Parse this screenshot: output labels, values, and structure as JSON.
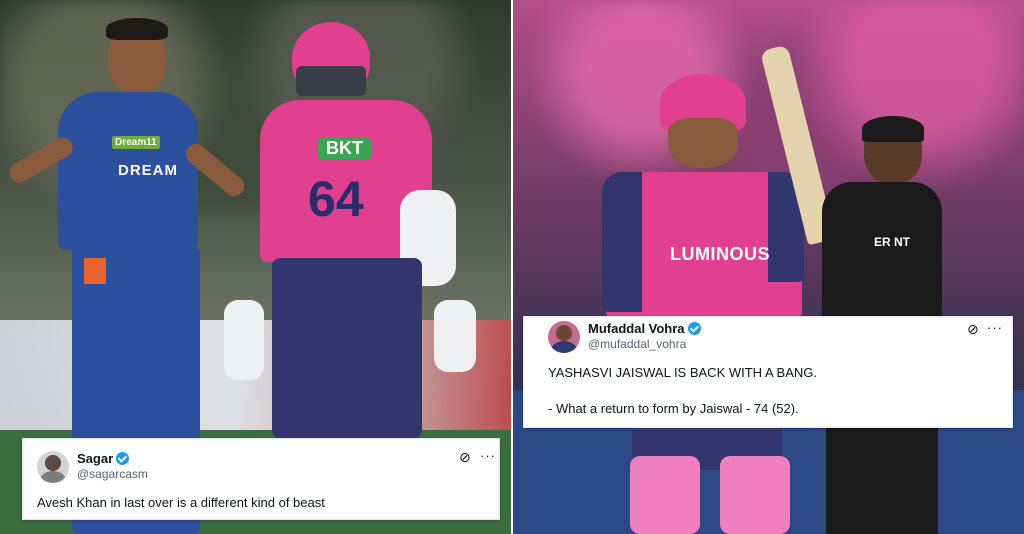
{
  "left_photo": {
    "bowler_jersey_sponsor": "DREAM",
    "bowler_jersey_badge": "Dream11",
    "batter_jersey_sponsor": "BKT",
    "batter_number": "64"
  },
  "right_photo": {
    "batter_jersey_sponsor": "LUMINOUS",
    "umpire_shirt_text": "ER NT"
  },
  "tweets": [
    {
      "name": "Sagar",
      "handle": "@sagarcasm",
      "verified": true,
      "lines": [
        "Avesh Khan in last over is a different kind of beast"
      ]
    },
    {
      "name": "Mufaddal Vohra",
      "handle": "@mufaddal_vohra",
      "verified": true,
      "lines": [
        "YASHASVI JAISWAL IS BACK WITH A BANG.",
        "- What a return to form by Jaiswal - 74 (52)."
      ]
    }
  ],
  "icons": {
    "grok": "⊘",
    "more": "···"
  },
  "colors": {
    "lsg_blue": "#2c4f9e",
    "rr_pink": "#e0408f",
    "verified_blue": "#1d9bf0"
  }
}
